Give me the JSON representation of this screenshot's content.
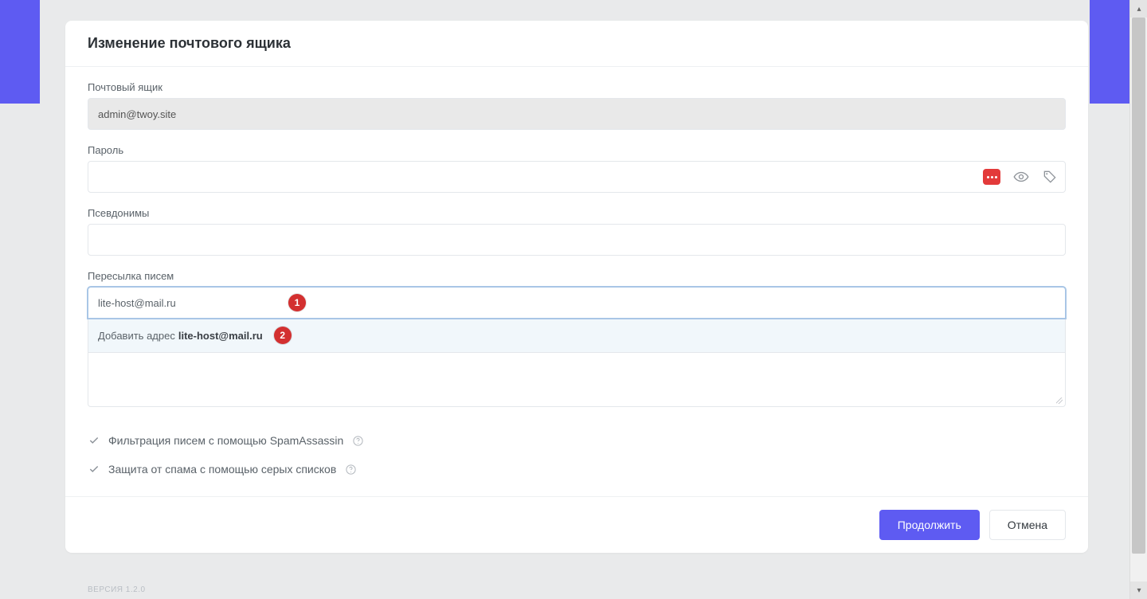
{
  "title": "Изменение почтового ящика",
  "fields": {
    "mailbox": {
      "label": "Почтовый ящик",
      "value": "admin@twoy.site"
    },
    "password": {
      "label": "Пароль",
      "value": ""
    },
    "aliases": {
      "label": "Псевдонимы",
      "value": ""
    },
    "forward": {
      "label": "Пересылка писем",
      "value": "lite-host@mail.ru"
    }
  },
  "suggest": {
    "prefix": "Добавить адрес",
    "address": "lite-host@mail.ru"
  },
  "badges": {
    "input": "1",
    "suggest": "2"
  },
  "checks": {
    "spamassassin": "Фильтрация писем с помощью SpamAssassin",
    "greylist": "Защита от спама с помощью серых списков"
  },
  "actions": {
    "submit": "Продолжить",
    "cancel": "Отмена"
  },
  "footer": {
    "version": "ВЕРСИЯ 1.2.0"
  },
  "colors": {
    "accent": "#5e5bf2",
    "badge": "#d33030",
    "genBtn": "#e33a3a"
  }
}
